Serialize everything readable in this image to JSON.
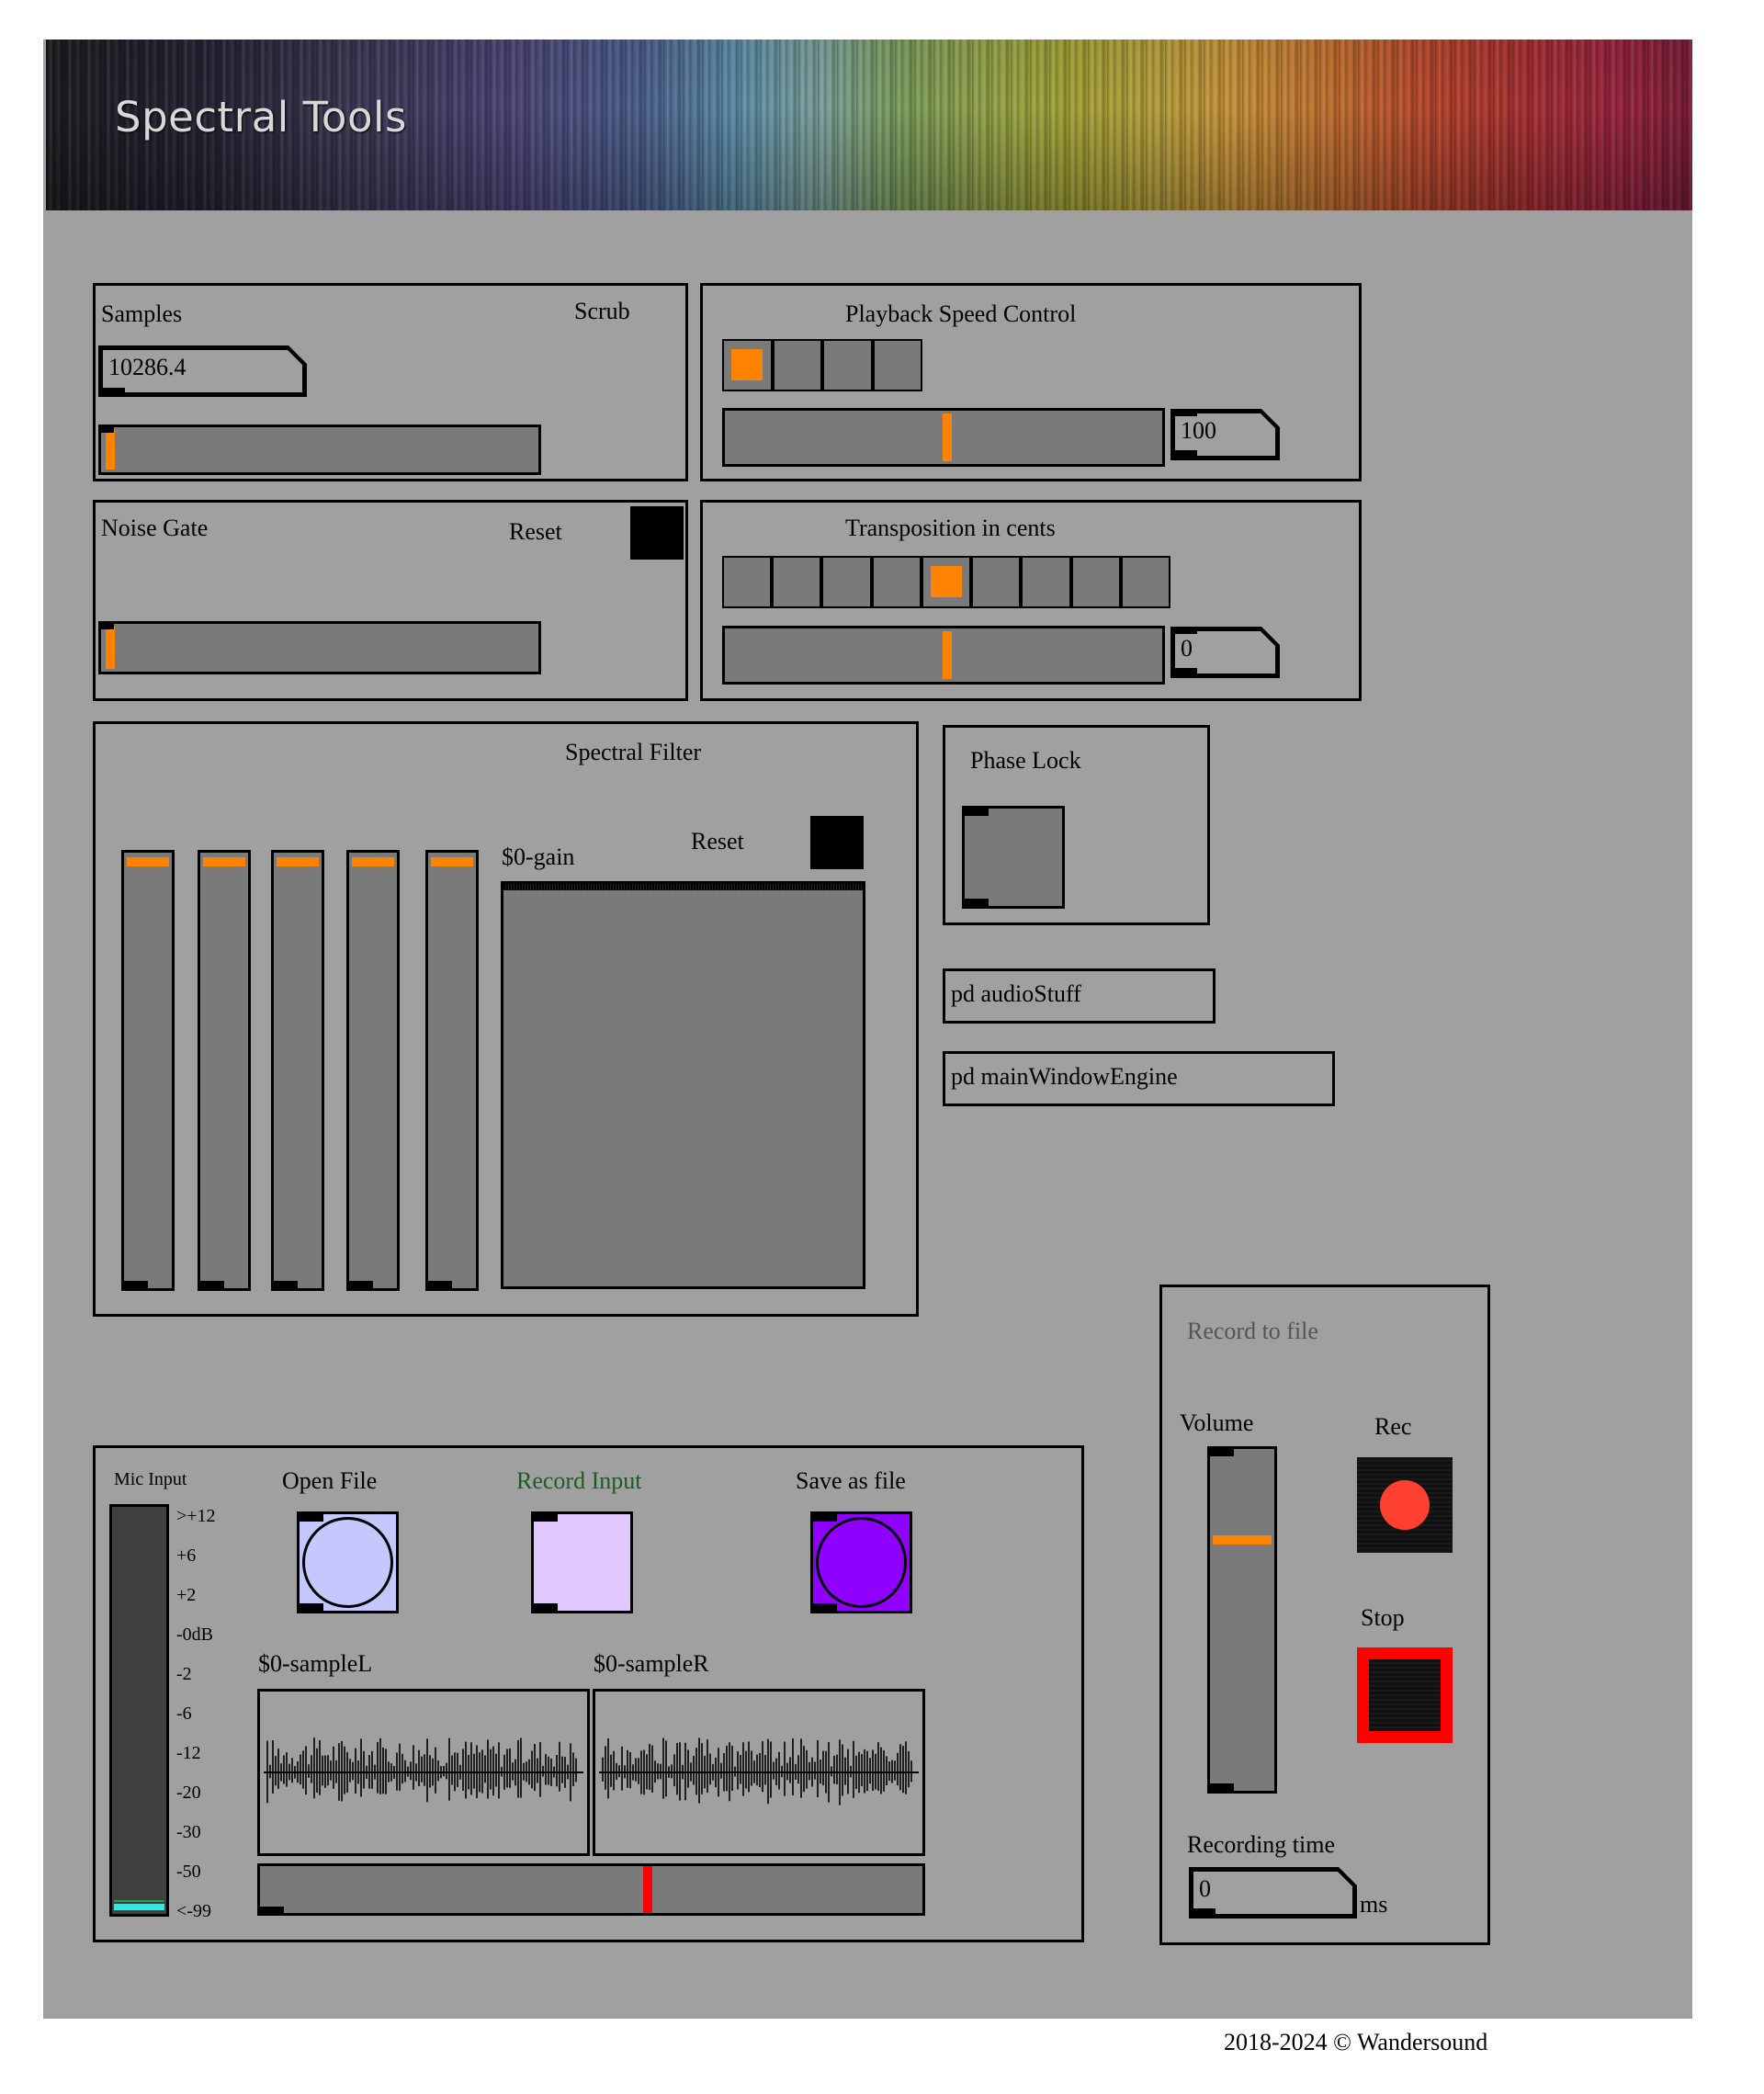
{
  "banner": {
    "title": "Spectral Tools"
  },
  "samples_panel": {
    "label": "Samples",
    "scrub_label": "Scrub",
    "value": "10286.4",
    "slider_position": 0.02
  },
  "speed_panel": {
    "label": "Playback Speed Control",
    "selected_cell": 0,
    "cell_count": 4,
    "slider_position": 0.5,
    "value": "100"
  },
  "noise_gate_panel": {
    "label": "Noise Gate",
    "reset_label": "Reset",
    "slider_position": 0.02
  },
  "transposition_panel": {
    "label": "Transposition in cents",
    "selected_cell": 4,
    "cell_count": 9,
    "slider_position": 0.5,
    "value": "0"
  },
  "spectral_filter": {
    "label": "Spectral Filter",
    "gain_array_label": "$0-gain",
    "reset_label": "Reset",
    "slider_count": 5,
    "slider_levels": [
      1.0,
      1.0,
      1.0,
      1.0,
      1.0
    ]
  },
  "phase_lock": {
    "label": "Phase Lock"
  },
  "subpatches": {
    "audio": "pd audioStuff",
    "engine": "pd mainWindowEngine"
  },
  "io_panel": {
    "mic_label": "Mic Input",
    "meter_scale": [
      ">+12",
      "+6",
      "+2",
      "-0dB",
      "-2",
      "-6",
      "-12",
      "-20",
      "-30",
      "-50",
      "<-99"
    ],
    "open_label": "Open File",
    "record_input_label": "Record Input",
    "save_label": "Save as file",
    "sample_left_label": "$0-sampleL",
    "sample_right_label": "$0-sampleR",
    "playhead_position": 0.58
  },
  "record_panel": {
    "title": "Record to file",
    "volume_label": "Volume",
    "volume_level": 0.77,
    "rec_label": "Rec",
    "stop_label": "Stop",
    "time_label": "Recording time",
    "time_value": "0",
    "time_unit": "ms"
  },
  "footer": {
    "copyright": "2018-2024 © Wandersound"
  },
  "colors": {
    "canvas": "#a0a0a0",
    "widget": "#7a7a7a",
    "accent": "#ff8200",
    "record_input_text": "#1b5e20",
    "open_bang": "#c4c8ff",
    "record_bang": "#e0c8ff",
    "save_bang": "#9000ff",
    "rec_dot": "#ff4030",
    "stop_frame": "#ff0000",
    "playhead": "#ff0000",
    "meter_bg": "#404040",
    "meter_level": "#40e0e0"
  }
}
